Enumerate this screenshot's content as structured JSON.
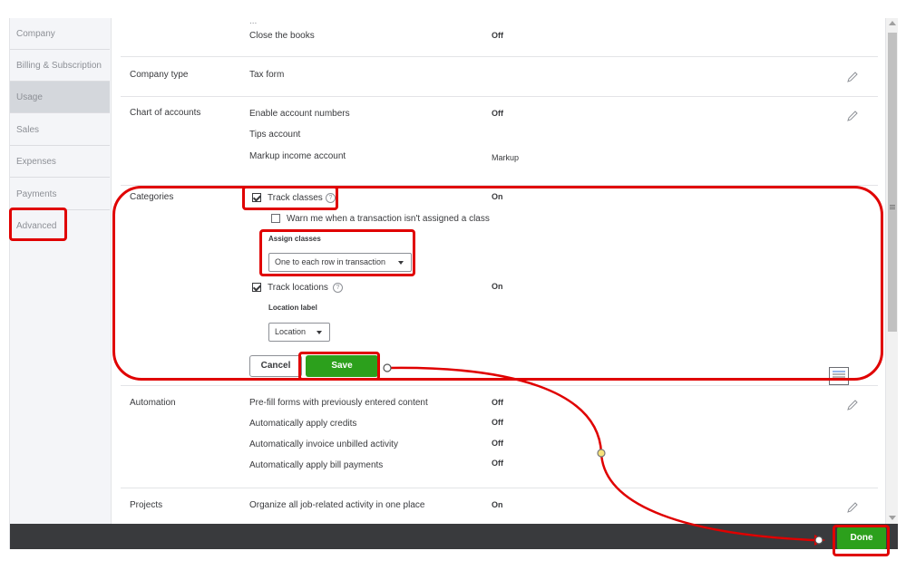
{
  "left_nav": {
    "items": [
      {
        "label": "Company"
      },
      {
        "label": "Billing & Subscription"
      },
      {
        "label": "Usage"
      },
      {
        "label": "Sales"
      },
      {
        "label": "Expenses"
      },
      {
        "label": "Payments"
      },
      {
        "label": "Advanced"
      }
    ],
    "active_index": 2
  },
  "sections": {
    "accounting_partial": {
      "row_label": "Close the books",
      "row_value": "Off"
    },
    "company_type": {
      "label": "Company type",
      "rows": [
        {
          "label": "Tax form",
          "value": ""
        }
      ]
    },
    "chart_of_accounts": {
      "label": "Chart of accounts",
      "rows": [
        {
          "label": "Enable account numbers",
          "value": "Off"
        },
        {
          "label": "Tips account",
          "value": ""
        },
        {
          "label": "Markup income account",
          "value": "Markup"
        }
      ]
    },
    "categories": {
      "label": "Categories",
      "track_classes_label": "Track classes",
      "track_classes_checked": true,
      "track_classes_value": "On",
      "warn_label": "Warn me when a transaction isn't assigned a class",
      "warn_checked": false,
      "assign_classes_label": "Assign classes",
      "assign_classes_selected": "One to each row in transaction",
      "track_locations_label": "Track locations",
      "track_locations_checked": true,
      "track_locations_value": "On",
      "location_label_heading": "Location label",
      "location_label_selected": "Location",
      "cancel_label": "Cancel",
      "save_label": "Save"
    },
    "automation": {
      "label": "Automation",
      "rows": [
        {
          "label": "Pre-fill forms with previously entered content",
          "value": "Off"
        },
        {
          "label": "Automatically apply credits",
          "value": "Off"
        },
        {
          "label": "Automatically invoice unbilled activity",
          "value": "Off"
        },
        {
          "label": "Automatically apply bill payments",
          "value": "Off"
        }
      ]
    },
    "projects": {
      "label": "Projects",
      "rows": [
        {
          "label": "Organize all job-related activity in one place",
          "value": "On"
        }
      ]
    }
  },
  "footer": {
    "done_label": "Done"
  },
  "colors": {
    "accent_green": "#2ca01c",
    "annotation_red": "#e00000",
    "footer_dark": "#393a3d"
  }
}
